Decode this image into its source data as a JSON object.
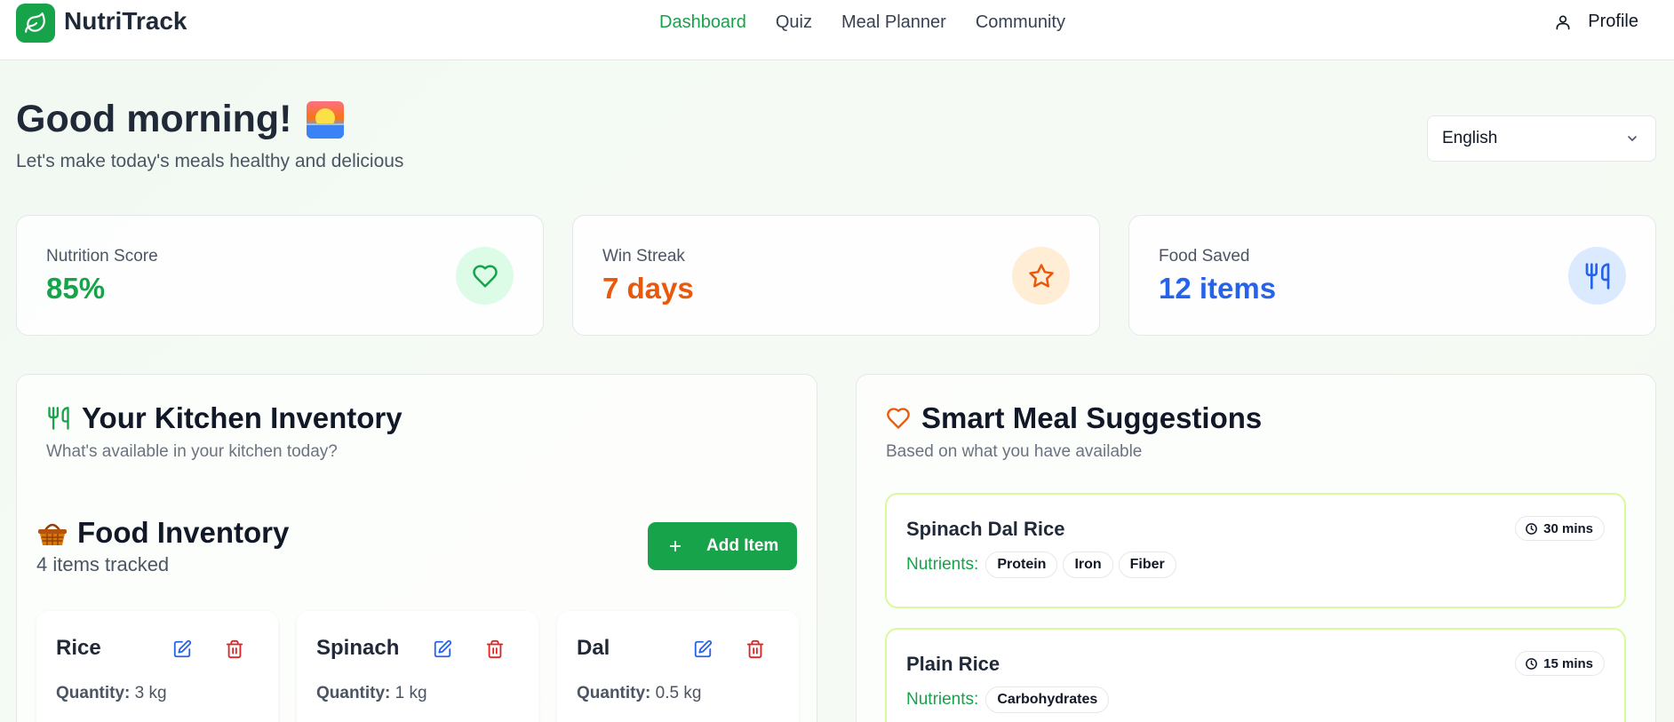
{
  "header": {
    "brand": "NutriTrack",
    "nav": [
      "Dashboard",
      "Quiz",
      "Meal Planner",
      "Community"
    ],
    "active_nav": "Dashboard",
    "profile_label": "Profile"
  },
  "greeting": {
    "title": "Good morning!",
    "emoji_icon": "sunrise-icon",
    "subtitle": "Let's make today's meals healthy and delicious"
  },
  "language": {
    "selected": "English"
  },
  "stats": [
    {
      "label": "Nutrition Score",
      "value": "85%",
      "icon": "heart-icon",
      "color": "#16a34a",
      "bg": "#dcfce7"
    },
    {
      "label": "Win Streak",
      "value": "7 days",
      "icon": "star-icon",
      "color": "#ea580c",
      "bg": "#ffedd5"
    },
    {
      "label": "Food Saved",
      "value": "12 items",
      "icon": "utensils-icon",
      "color": "#2563eb",
      "bg": "#dbeafe"
    }
  ],
  "inventory": {
    "title": "Your Kitchen Inventory",
    "subtitle": "What's available in your kitchen today?",
    "section_title": "Food Inventory",
    "count_text": "4 items tracked",
    "add_label": "Add Item",
    "quantity_label": "Quantity:",
    "items": [
      {
        "name": "Rice",
        "quantity": "3 kg"
      },
      {
        "name": "Spinach",
        "quantity": "1 kg"
      },
      {
        "name": "Dal",
        "quantity": "0.5 kg"
      }
    ]
  },
  "suggestions": {
    "title": "Smart Meal Suggestions",
    "subtitle": "Based on what you have available",
    "nutrients_label": "Nutrients:",
    "meals": [
      {
        "name": "Spinach Dal Rice",
        "time": "30 mins",
        "nutrients": [
          "Protein",
          "Iron",
          "Fiber"
        ]
      },
      {
        "name": "Plain Rice",
        "time": "15 mins",
        "nutrients": [
          "Carbohydrates"
        ]
      }
    ]
  }
}
